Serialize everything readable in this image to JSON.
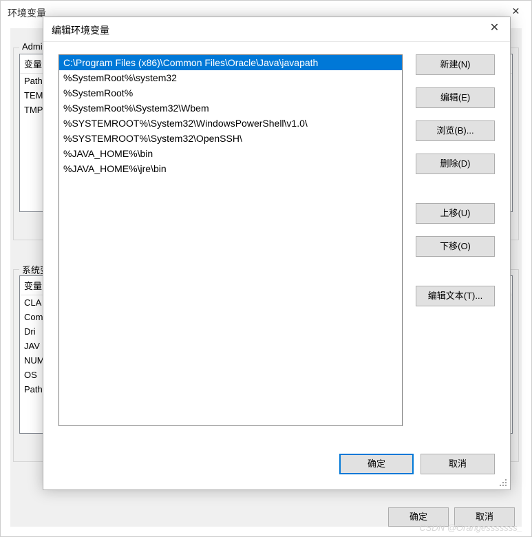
{
  "bgWindow": {
    "title": "环境变量",
    "close": "✕",
    "section1": {
      "label": "Admin",
      "header": "变量",
      "rows": [
        "Path",
        "TEM",
        "TMP"
      ]
    },
    "section2": {
      "label": "系统变",
      "header": "变量",
      "rows": [
        "CLA",
        "Com",
        "Dri",
        "JAV",
        "NUM",
        "OS",
        "Path"
      ]
    },
    "ok": "确定",
    "cancel": "取消"
  },
  "modal": {
    "title": "编辑环境变量",
    "close": "✕",
    "paths": [
      "C:\\Program Files (x86)\\Common Files\\Oracle\\Java\\javapath",
      "%SystemRoot%\\system32",
      "%SystemRoot%",
      "%SystemRoot%\\System32\\Wbem",
      "%SYSTEMROOT%\\System32\\WindowsPowerShell\\v1.0\\",
      "%SYSTEMROOT%\\System32\\OpenSSH\\",
      "%JAVA_HOME%\\bin",
      "%JAVA_HOME%\\jre\\bin"
    ],
    "selectedIndex": 0,
    "buttons": {
      "new": "新建(N)",
      "edit": "编辑(E)",
      "browse": "浏览(B)...",
      "delete": "删除(D)",
      "moveUp": "上移(U)",
      "moveDown": "下移(O)",
      "editText": "编辑文本(T)..."
    },
    "ok": "确定",
    "cancel": "取消"
  },
  "watermark": "CSDN @Orangesssssss_"
}
